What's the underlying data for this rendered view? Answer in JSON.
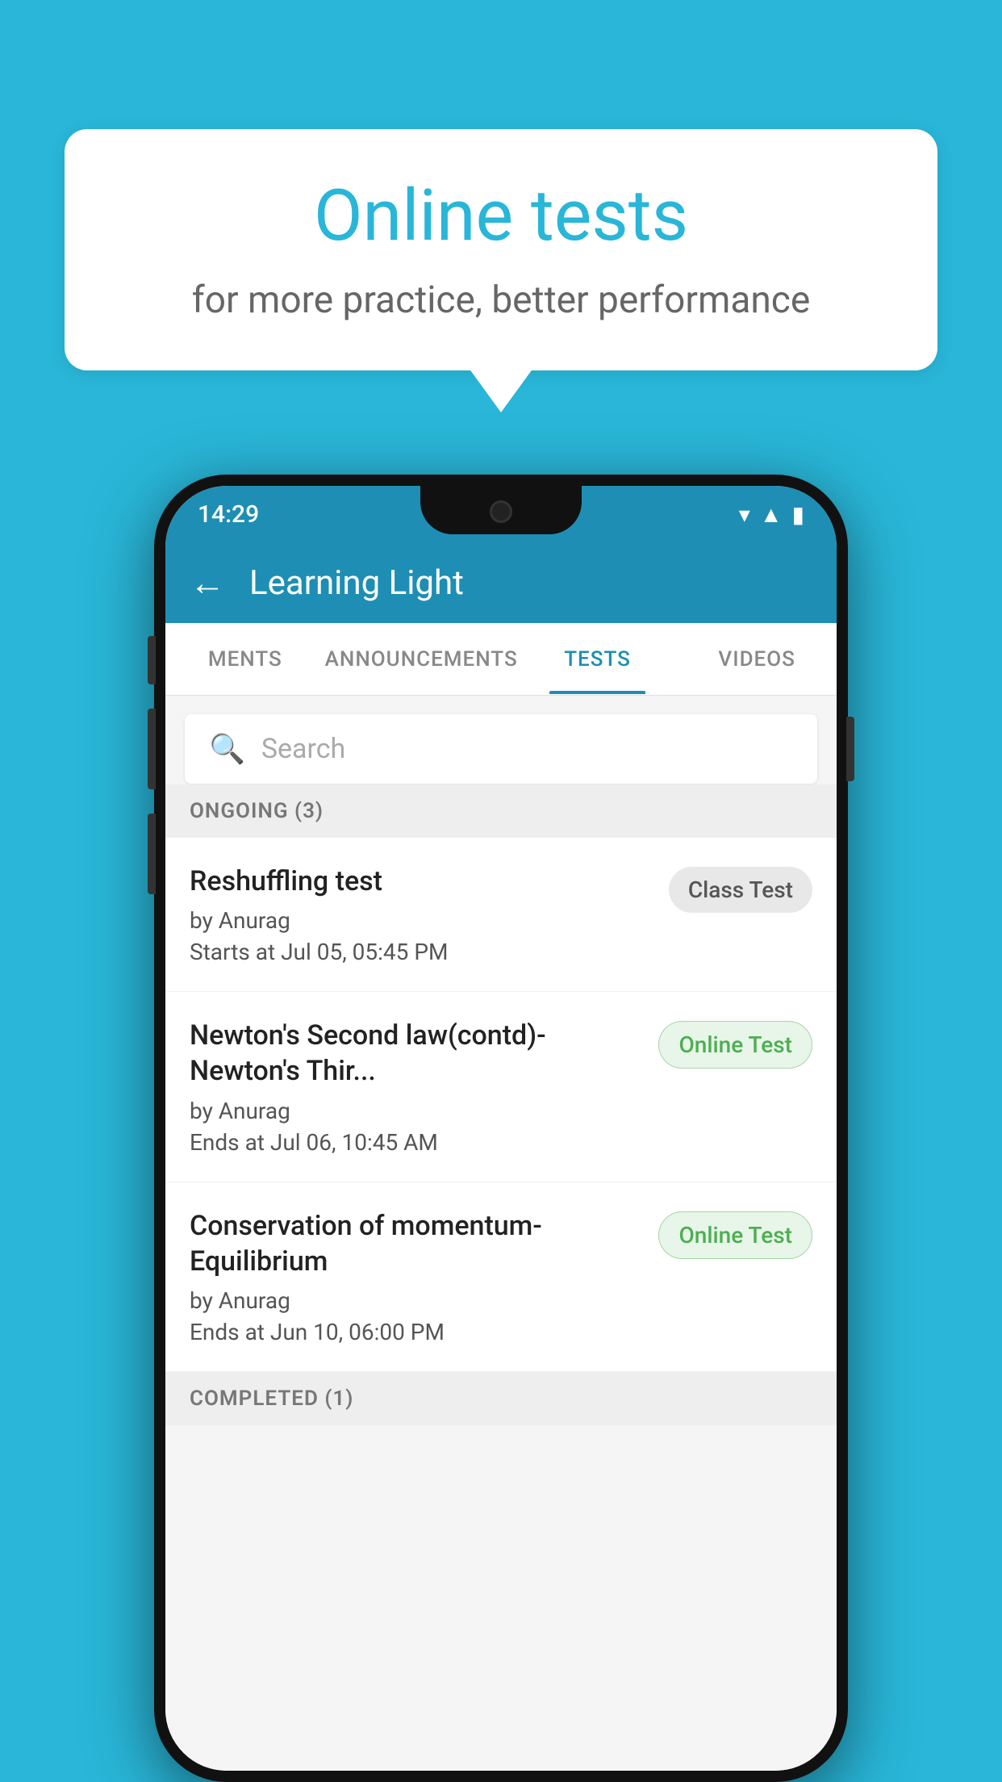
{
  "background_color": "#29b6d8",
  "speech_bubble": {
    "title": "Online tests",
    "subtitle": "for more practice, better performance"
  },
  "phone": {
    "status_bar": {
      "time": "14:29",
      "icons": [
        "wifi",
        "signal",
        "battery"
      ]
    },
    "app_bar": {
      "title": "Learning Light",
      "back_label": "←"
    },
    "tabs": [
      {
        "label": "MENTS",
        "active": false
      },
      {
        "label": "ANNOUNCEMENTS",
        "active": false
      },
      {
        "label": "TESTS",
        "active": true
      },
      {
        "label": "VIDEOS",
        "active": false
      }
    ],
    "search": {
      "placeholder": "Search"
    },
    "section_ongoing": {
      "label": "ONGOING (3)"
    },
    "tests": [
      {
        "title": "Reshuffling test",
        "author": "by Anurag",
        "date": "Starts at  Jul 05, 05:45 PM",
        "badge": "Class Test",
        "badge_type": "class"
      },
      {
        "title": "Newton's Second law(contd)-Newton's Thir...",
        "author": "by Anurag",
        "date": "Ends at  Jul 06, 10:45 AM",
        "badge": "Online Test",
        "badge_type": "online"
      },
      {
        "title": "Conservation of momentum-Equilibrium",
        "author": "by Anurag",
        "date": "Ends at  Jun 10, 06:00 PM",
        "badge": "Online Test",
        "badge_type": "online"
      }
    ],
    "section_completed": {
      "label": "COMPLETED (1)"
    }
  }
}
